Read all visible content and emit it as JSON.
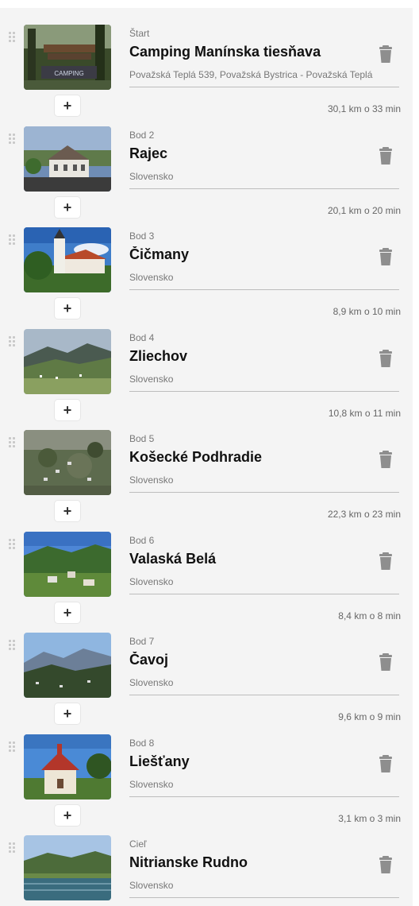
{
  "route": {
    "add_label": "+",
    "stops": [
      {
        "label": "Štart",
        "name": "Camping Manínska tiesňava",
        "address": "Považská Teplá 539, Považská Bystrica - Považská Teplá",
        "image": "camping-sign",
        "distance": "30,1 km o 33 min"
      },
      {
        "label": "Bod 2",
        "name": "Rajec",
        "address": "Slovensko",
        "image": "town-hall",
        "distance": "20,1 km o 20 min"
      },
      {
        "label": "Bod 3",
        "name": "Čičmany",
        "address": "Slovensko",
        "image": "church",
        "distance": "8,9 km o 10 min"
      },
      {
        "label": "Bod 4",
        "name": "Zliechov",
        "address": "Slovensko",
        "image": "valley",
        "distance": "10,8 km o 11 min"
      },
      {
        "label": "Bod 5",
        "name": "Košecké Podhradie",
        "address": "Slovensko",
        "image": "aerial-village",
        "distance": "22,3 km o 23 min"
      },
      {
        "label": "Bod 6",
        "name": "Valaská Belá",
        "address": "Slovensko",
        "image": "hills-village",
        "distance": "8,4 km o 8 min"
      },
      {
        "label": "Bod 7",
        "name": "Čavoj",
        "address": "Slovensko",
        "image": "mountain-panorama",
        "distance": "9,6 km o 9 min"
      },
      {
        "label": "Bod 8",
        "name": "Liešťany",
        "address": "Slovensko",
        "image": "chapel",
        "distance": "3,1 km o 3 min"
      },
      {
        "label": "Cieľ",
        "name": "Nitrianske Rudno",
        "address": "Slovensko",
        "image": "lake",
        "distance": ""
      }
    ]
  },
  "colors": {
    "panel_bg": "#f4f4f4",
    "text_primary": "#111111",
    "text_secondary": "#777777",
    "trash": "#8e8e8e"
  }
}
